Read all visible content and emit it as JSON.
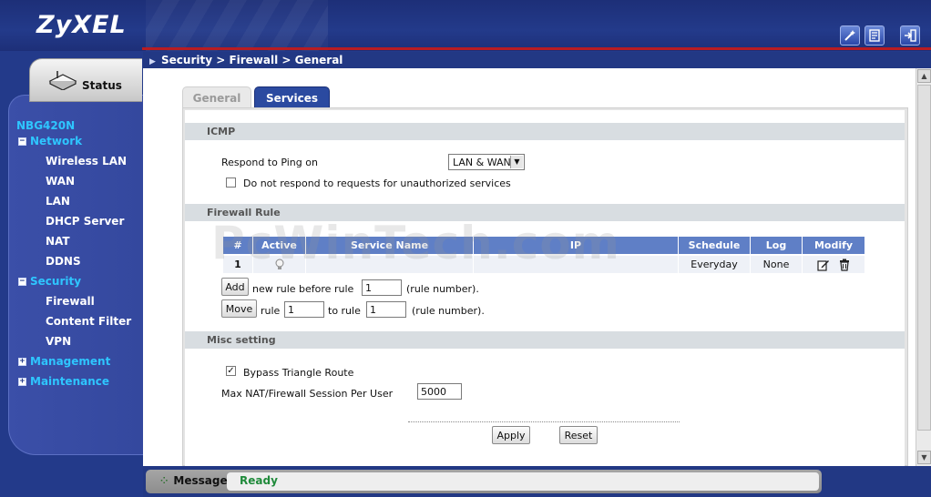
{
  "brand": {
    "logo_text": "ZyXEL"
  },
  "header": {
    "buttons": [
      {
        "name": "wizard",
        "icon": "magic-wand-icon"
      },
      {
        "name": "about",
        "icon": "document-icon"
      },
      {
        "name": "logout",
        "icon": "logout-icon"
      }
    ]
  },
  "nav": {
    "status_label": "Status",
    "model": "NBG420N",
    "groups": [
      {
        "label": "Network",
        "expanded": true,
        "items": [
          "Wireless LAN",
          "WAN",
          "LAN",
          "DHCP Server",
          "NAT",
          "DDNS"
        ]
      },
      {
        "label": "Security",
        "expanded": true,
        "items": [
          "Firewall",
          "Content Filter",
          "VPN"
        ]
      },
      {
        "label": "Management",
        "expanded": false,
        "items": []
      },
      {
        "label": "Maintenance",
        "expanded": false,
        "items": []
      }
    ]
  },
  "breadcrumb": "Security > Firewall > General",
  "tabs": [
    {
      "label": "General",
      "active": false
    },
    {
      "label": "Services",
      "active": true
    }
  ],
  "icmp": {
    "section_title": "ICMP",
    "respond_label": "Respond to Ping on",
    "respond_value": "LAN & WAN",
    "unauth_label": "Do not respond to requests for unauthorized services",
    "unauth_checked": false
  },
  "firewall_rule": {
    "section_title": "Firewall Rule",
    "columns": [
      "#",
      "Active",
      "Service Name",
      "IP",
      "Schedule",
      "Log",
      "Modify"
    ],
    "rows": [
      {
        "num": "1",
        "active": "bulb-icon",
        "service": "",
        "ip": "",
        "schedule": "Everyday",
        "log": "None"
      }
    ],
    "add_button": "Add",
    "add_text": "new rule before rule",
    "add_value": "1",
    "add_suffix": "(rule number).",
    "move_button": "Move",
    "move_text": "rule",
    "move_from": "1",
    "move_to_text": "to rule",
    "move_to": "1",
    "move_suffix": "(rule number)."
  },
  "misc": {
    "section_title": "Misc setting",
    "bypass_label": "Bypass Triangle Route",
    "bypass_checked": true,
    "max_label": "Max NAT/Firewall Session Per User",
    "max_value": "5000"
  },
  "actions": {
    "apply": "Apply",
    "reset": "Reset"
  },
  "message": {
    "label": "Message",
    "value": "Ready"
  },
  "watermark": "PcWinTech.com",
  "colors": {
    "accent": "#233a8a",
    "tab_active": "#2b4aa0",
    "section": "#d8dde1",
    "table_header": "#5f7fc6",
    "status_ok": "#1f8a3a",
    "nav_group": "#2ec6ff"
  }
}
